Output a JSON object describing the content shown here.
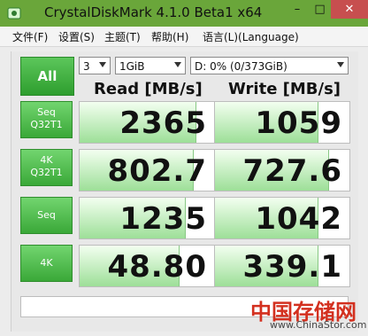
{
  "window": {
    "title": "CrystalDiskMark 4.1.0 Beta1 x64",
    "controls": {
      "minimize": "–",
      "maximize": "□",
      "close": "✕"
    }
  },
  "menu": {
    "items": [
      "文件(F)",
      "设置(S)",
      "主题(T)",
      "帮助(H)",
      "语言(L)(Language)"
    ]
  },
  "toolbar": {
    "all_label": "All",
    "count": "3",
    "size": "1GiB",
    "drive": "D: 0% (0/373GiB)"
  },
  "headers": {
    "read": "Read [MB/s]",
    "write": "Write [MB/s]"
  },
  "rows": [
    {
      "label": "Seq\nQ32T1",
      "read": "2365",
      "write": "1059",
      "read_fill": 0.86,
      "write_fill": 0.76
    },
    {
      "label": "4K\nQ32T1",
      "read": "802.7",
      "write": "727.6",
      "read_fill": 0.84,
      "write_fill": 0.84
    },
    {
      "label": "Seq",
      "read": "1235",
      "write": "1042",
      "read_fill": 0.78,
      "write_fill": 0.76
    },
    {
      "label": "4K",
      "read": "48.80",
      "write": "339.1",
      "read_fill": 0.74,
      "write_fill": 0.76
    }
  ],
  "watermark": {
    "text": "中国存储网",
    "url": "www.ChinaStor.com"
  },
  "colors": {
    "accent": "#3aa838",
    "bar": "#9ddf98",
    "close": "#c74f4f",
    "titlebar": "#6aa63a"
  },
  "icons": [
    "app-icon"
  ]
}
